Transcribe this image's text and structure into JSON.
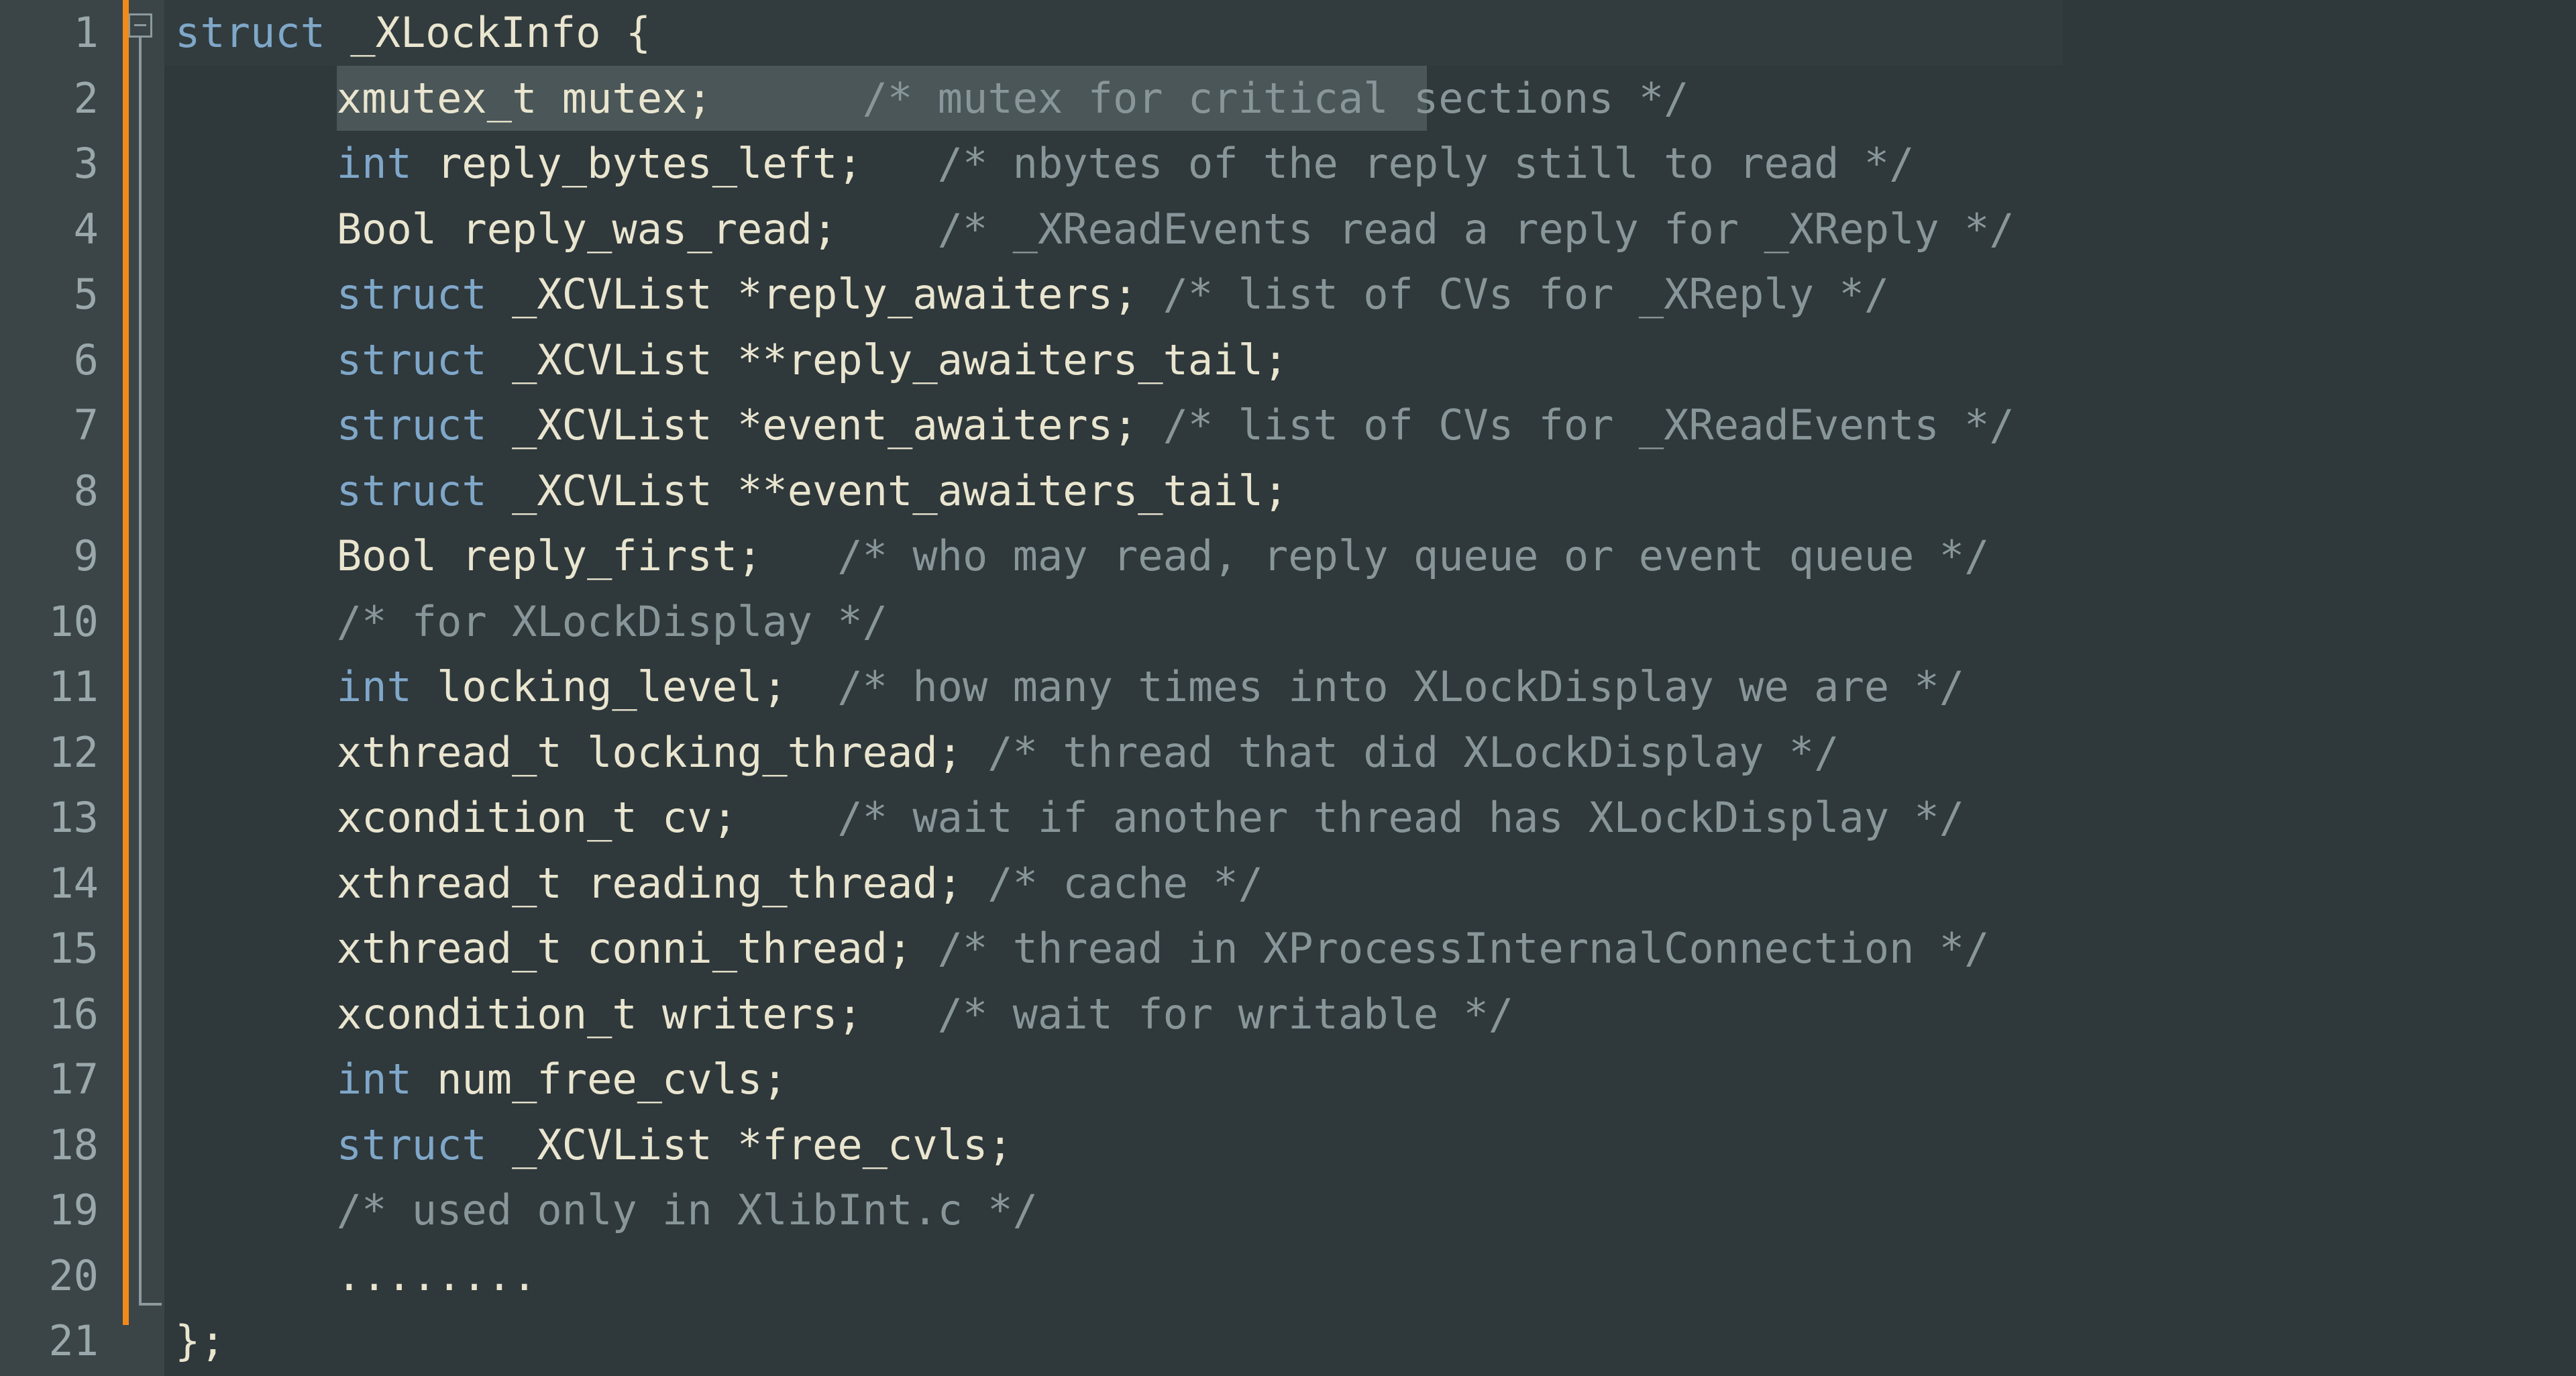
{
  "editor": {
    "language": "C",
    "theme": "dark",
    "colors": {
      "background": "#2f383b",
      "gutter_background": "#3b4548",
      "line_number": "#9aa8ab",
      "keyword": "#7fa7c9",
      "identifier": "#e9e5cf",
      "comment": "#889699",
      "selection": "#4a5658",
      "current_line": "#323c3e",
      "change_marker": "#f08a1b",
      "fold_guide": "#8c9a9e"
    },
    "gutter": {
      "line_numbers": [
        "1",
        "2",
        "3",
        "4",
        "5",
        "6",
        "7",
        "8",
        "9",
        "10",
        "11",
        "12",
        "13",
        "14",
        "15",
        "16",
        "17",
        "18",
        "19",
        "20",
        "21"
      ],
      "fold_marker_line": 1,
      "fold_marker_state": "expanded",
      "fold_icon": "fold-minus-icon",
      "change_marker_icon": "vcs-modified-bar"
    },
    "selection": {
      "line": 2,
      "text": "xmutex_t mutex;      /* mutex for critical sections */"
    },
    "lines": [
      {
        "number": "1",
        "indent": 0,
        "tokens": [
          {
            "t": "kw",
            "v": "struct"
          },
          {
            "t": "id",
            "v": " _XLockInfo {"
          }
        ]
      },
      {
        "number": "2",
        "indent": 1,
        "tokens": [
          {
            "t": "id",
            "v": "xmutex_t mutex;"
          },
          {
            "t": "cmt",
            "v": "      /* mutex for critical sections */"
          }
        ]
      },
      {
        "number": "3",
        "indent": 1,
        "tokens": [
          {
            "t": "kw",
            "v": "int"
          },
          {
            "t": "id",
            "v": " reply_bytes_left;"
          },
          {
            "t": "cmt",
            "v": "   /* nbytes of the reply still to read */"
          }
        ]
      },
      {
        "number": "4",
        "indent": 1,
        "tokens": [
          {
            "t": "id",
            "v": "Bool reply_was_read;"
          },
          {
            "t": "cmt",
            "v": "    /* _XReadEvents read a reply for _XReply */"
          }
        ]
      },
      {
        "number": "5",
        "indent": 1,
        "tokens": [
          {
            "t": "kw",
            "v": "struct"
          },
          {
            "t": "id",
            "v": " _XCVList *reply_awaiters;"
          },
          {
            "t": "cmt",
            "v": " /* list of CVs for _XReply */"
          }
        ]
      },
      {
        "number": "6",
        "indent": 1,
        "tokens": [
          {
            "t": "kw",
            "v": "struct"
          },
          {
            "t": "id",
            "v": " _XCVList **reply_awaiters_tail;"
          }
        ]
      },
      {
        "number": "7",
        "indent": 1,
        "tokens": [
          {
            "t": "kw",
            "v": "struct"
          },
          {
            "t": "id",
            "v": " _XCVList *event_awaiters;"
          },
          {
            "t": "cmt",
            "v": " /* list of CVs for _XReadEvents */"
          }
        ]
      },
      {
        "number": "8",
        "indent": 1,
        "tokens": [
          {
            "t": "kw",
            "v": "struct"
          },
          {
            "t": "id",
            "v": " _XCVList **event_awaiters_tail;"
          }
        ]
      },
      {
        "number": "9",
        "indent": 1,
        "tokens": [
          {
            "t": "id",
            "v": "Bool reply_first;"
          },
          {
            "t": "cmt",
            "v": "   /* who may read, reply queue or event queue */"
          }
        ]
      },
      {
        "number": "10",
        "indent": 1,
        "tokens": [
          {
            "t": "cmt",
            "v": "/* for XLockDisplay */"
          }
        ]
      },
      {
        "number": "11",
        "indent": 1,
        "tokens": [
          {
            "t": "kw",
            "v": "int"
          },
          {
            "t": "id",
            "v": " locking_level;"
          },
          {
            "t": "cmt",
            "v": "  /* how many times into XLockDisplay we are */"
          }
        ]
      },
      {
        "number": "12",
        "indent": 1,
        "tokens": [
          {
            "t": "id",
            "v": "xthread_t locking_thread;"
          },
          {
            "t": "cmt",
            "v": " /* thread that did XLockDisplay */"
          }
        ]
      },
      {
        "number": "13",
        "indent": 1,
        "tokens": [
          {
            "t": "id",
            "v": "xcondition_t cv;"
          },
          {
            "t": "cmt",
            "v": "    /* wait if another thread has XLockDisplay */"
          }
        ]
      },
      {
        "number": "14",
        "indent": 1,
        "tokens": [
          {
            "t": "id",
            "v": "xthread_t reading_thread;"
          },
          {
            "t": "cmt",
            "v": " /* cache */"
          }
        ]
      },
      {
        "number": "15",
        "indent": 1,
        "tokens": [
          {
            "t": "id",
            "v": "xthread_t conni_thread;"
          },
          {
            "t": "cmt",
            "v": " /* thread in XProcessInternalConnection */"
          }
        ]
      },
      {
        "number": "16",
        "indent": 1,
        "tokens": [
          {
            "t": "id",
            "v": "xcondition_t writers;"
          },
          {
            "t": "cmt",
            "v": "   /* wait for writable */"
          }
        ]
      },
      {
        "number": "17",
        "indent": 1,
        "tokens": [
          {
            "t": "kw",
            "v": "int"
          },
          {
            "t": "id",
            "v": " num_free_cvls;"
          }
        ]
      },
      {
        "number": "18",
        "indent": 1,
        "tokens": [
          {
            "t": "kw",
            "v": "struct"
          },
          {
            "t": "id",
            "v": " _XCVList *free_cvls;"
          }
        ]
      },
      {
        "number": "19",
        "indent": 1,
        "tokens": [
          {
            "t": "cmt",
            "v": "/* used only in XlibInt.c */"
          }
        ]
      },
      {
        "number": "20",
        "indent": 1,
        "tokens": [
          {
            "t": "id",
            "v": "........"
          }
        ]
      },
      {
        "number": "21",
        "indent": 0,
        "tokens": [
          {
            "t": "id",
            "v": "};"
          }
        ]
      }
    ]
  }
}
